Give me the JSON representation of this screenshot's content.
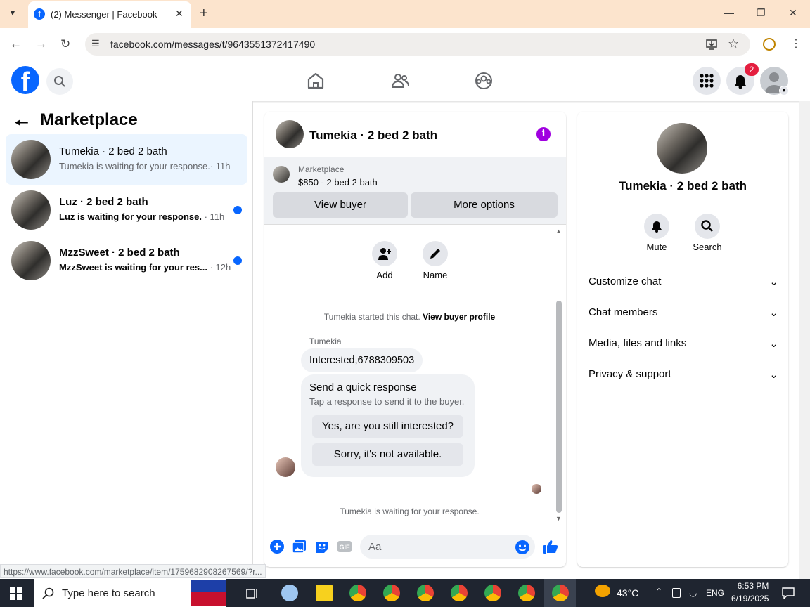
{
  "browser": {
    "tab_title": "(2) Messenger | Facebook",
    "url": "facebook.com/messages/t/9643551372417490",
    "status_url": "https://www.facebook.com/marketplace/item/1759682908267569/?r..."
  },
  "header": {
    "notification_count": "2"
  },
  "left": {
    "title": "Marketplace",
    "conversations": [
      {
        "name": "Tumekia · 2 bed 2 bath",
        "subtitle": "Tumekia is waiting for your response.",
        "time": "· 11h",
        "selected": true,
        "unread": false
      },
      {
        "name": "Luz · 2 bed 2 bath",
        "subtitle": "Luz is waiting for your response.",
        "time": "· 11h",
        "selected": false,
        "unread": true
      },
      {
        "name": "MzzSweet · 2 bed 2 bath",
        "subtitle": "MzzSweet is waiting for your res...",
        "time": "· 12h",
        "selected": false,
        "unread": true
      }
    ]
  },
  "chat": {
    "title": "Tumekia · 2 bed 2 bath",
    "marketplace_label": "Marketplace",
    "listing": "$850 - 2 bed 2 bath",
    "view_buyer": "View buyer",
    "more_options": "More options",
    "add_label": "Add",
    "name_label": "Name",
    "started_text": "Tumekia started this chat.",
    "view_profile": "View buyer profile",
    "sender": "Tumekia",
    "message": "Interested,6788309503",
    "quick_title": "Send a quick response",
    "quick_sub": "Tap a response to send it to the buyer.",
    "quick_1": "Yes, are you still interested?",
    "quick_2": "Sorry, it's not available.",
    "waiting": "Tumekia is waiting for your response.",
    "input_placeholder": "Aa"
  },
  "right": {
    "name": "Tumekia · 2 bed 2 bath",
    "mute": "Mute",
    "search": "Search",
    "sections": [
      "Customize chat",
      "Chat members",
      "Media, files and links",
      "Privacy & support"
    ]
  },
  "taskbar": {
    "search_placeholder": "Type here to search",
    "temperature": "43°C",
    "language": "ENG",
    "time": "6:53 PM",
    "date": "6/19/2025"
  },
  "colors": {
    "fb_blue": "#0866ff",
    "selected_bg": "#ebf5ff",
    "info_purple": "#a000e0",
    "badge_red": "#e41e3f"
  }
}
